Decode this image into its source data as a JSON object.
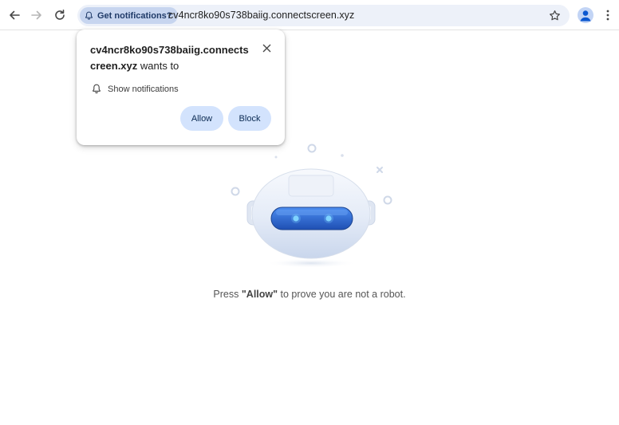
{
  "browser": {
    "chip_label": "Get notifications?",
    "url": "cv4ncr8ko90s738baiig.connectscreen.xyz"
  },
  "popup": {
    "title_domain": "cv4ncr8ko90s738baiig.connectscreen.xyz",
    "title_suffix": " wants to",
    "permission_label": "Show notifications",
    "allow_label": "Allow",
    "block_label": "Block"
  },
  "page": {
    "prompt_prefix": "Press ",
    "prompt_bold": "\"Allow\"",
    "prompt_suffix": " to prove you are not a robot."
  },
  "colors": {
    "chip_bg": "#c7d5ef",
    "button_bg": "#d3e3fd",
    "visor": "#2c67d6"
  },
  "icons": {
    "back": "arrow-left-icon",
    "forward": "arrow-right-icon",
    "reload": "reload-icon",
    "chip": "bell-icon",
    "bookmark": "star-icon",
    "profile": "person-icon",
    "menu": "kebab-menu-icon",
    "close": "close-icon",
    "permission": "bell-icon"
  }
}
